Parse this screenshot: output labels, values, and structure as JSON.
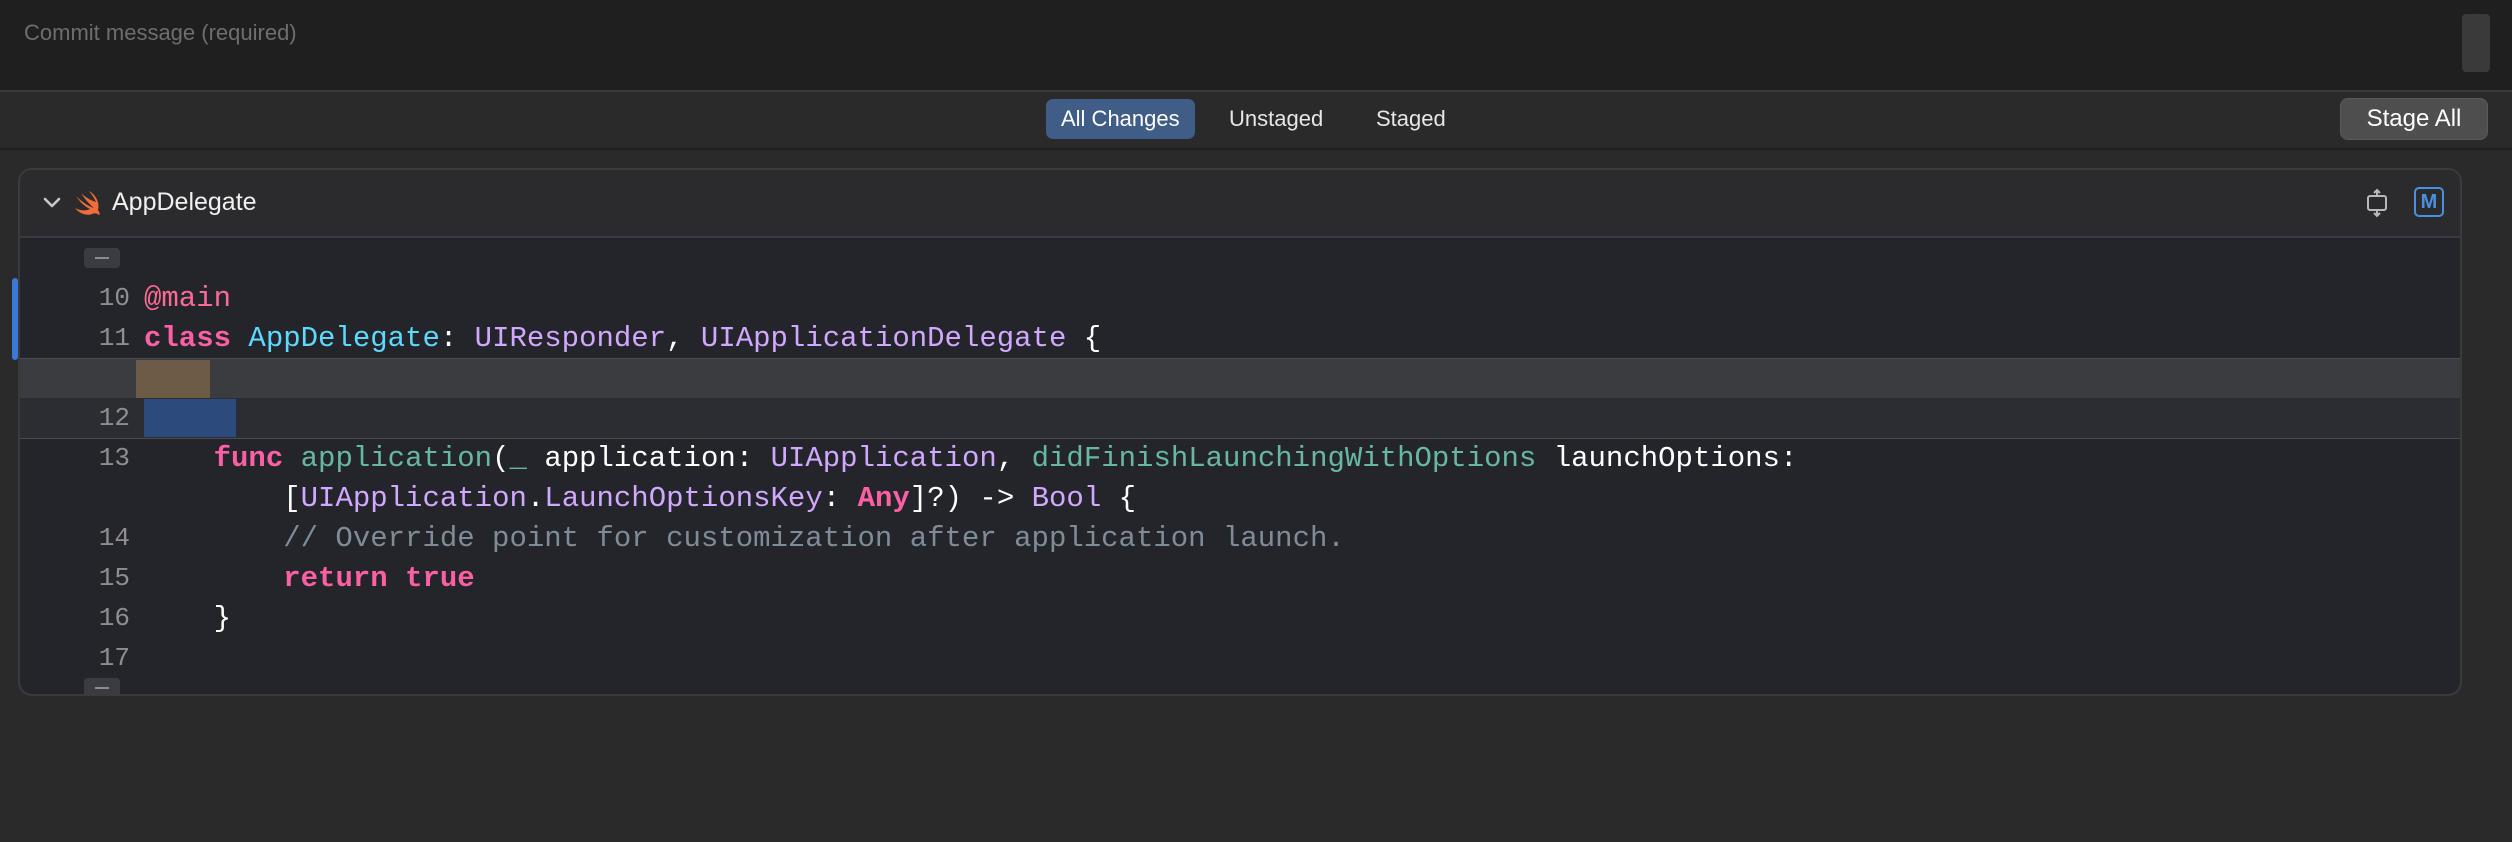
{
  "commit": {
    "placeholder": "Commit message (required)",
    "value": ""
  },
  "filters": {
    "tabs": [
      {
        "label": "All Changes",
        "active": true
      },
      {
        "label": "Unstaged",
        "active": false
      },
      {
        "label": "Staged",
        "active": false
      }
    ],
    "stage_all_label": "Stage All"
  },
  "file": {
    "name": "AppDelegate",
    "status_badge": "M",
    "icons": {
      "collapse": "chevron-down-icon",
      "language": "swift-icon",
      "expand": "expand-icon"
    }
  },
  "code": {
    "lines": [
      {
        "num": "10",
        "text": "@main"
      },
      {
        "num": "11",
        "text": "class AppDelegate: UIResponder, UIApplicationDelegate {"
      },
      {
        "num": "",
        "text": "",
        "change": "removed"
      },
      {
        "num": "12",
        "text": "",
        "change": "added"
      },
      {
        "num": "13",
        "text": "    func application(_ application: UIApplication, didFinishLaunchingWithOptions launchOptions:"
      },
      {
        "num": "",
        "text": "        [UIApplication.LaunchOptionsKey: Any]?) -> Bool {"
      },
      {
        "num": "14",
        "text": "        // Override point for customization after application launch."
      },
      {
        "num": "15",
        "text": "        return true"
      },
      {
        "num": "16",
        "text": "    }"
      },
      {
        "num": "17",
        "text": ""
      }
    ]
  },
  "colors": {
    "accent": "#3f5d86",
    "change_bar": "#3b78d8",
    "keyword": "#fc5fa3",
    "type": "#d0a8ff",
    "type_decl": "#5dd8ff",
    "function": "#67b7a4",
    "comment": "#7f8c98"
  }
}
